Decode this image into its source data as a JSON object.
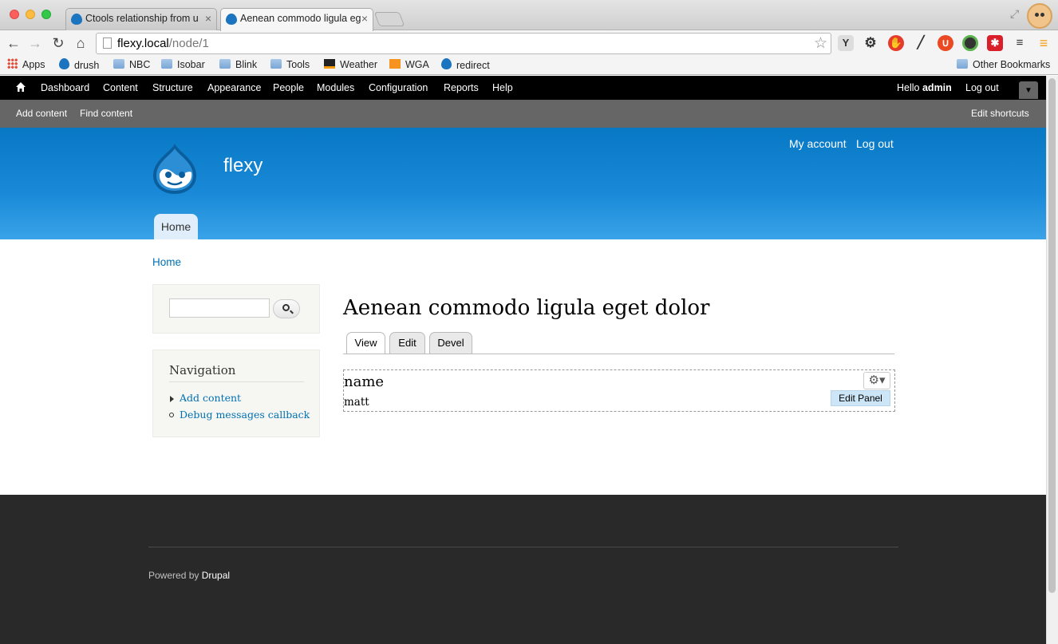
{
  "browser": {
    "tabs": [
      {
        "title": "Ctools relationship from u",
        "active": false
      },
      {
        "title": "Aenean commodo ligula eg",
        "active": true
      }
    ],
    "url": {
      "host": "flexy.local",
      "path": "/node/1"
    },
    "extensions": [
      "Y",
      "gear",
      "hand",
      "eyedropper",
      "stumbleupon",
      "chrome",
      "star-red",
      "tree",
      "menu"
    ],
    "bookmarks": [
      {
        "label": "Apps",
        "icon": "apps-icon"
      },
      {
        "label": "drush",
        "icon": "drupal-icon"
      },
      {
        "label": "NBC",
        "icon": "folder-icon"
      },
      {
        "label": "Isobar",
        "icon": "folder-icon"
      },
      {
        "label": "Blink",
        "icon": "folder-icon"
      },
      {
        "label": "Tools",
        "icon": "folder-icon"
      },
      {
        "label": "Weather",
        "icon": "weather-icon"
      },
      {
        "label": "WGA",
        "icon": "wga-icon"
      },
      {
        "label": "redirect",
        "icon": "drupal-icon"
      }
    ],
    "other_bookmarks": "Other Bookmarks"
  },
  "admin_menu": {
    "items": [
      "Dashboard",
      "Content",
      "Structure",
      "Appearance",
      "People",
      "Modules",
      "Configuration",
      "Reports",
      "Help"
    ],
    "hello": "Hello",
    "user": "admin",
    "logout": "Log out"
  },
  "shortcuts": {
    "items": [
      "Add content",
      "Find content"
    ],
    "edit": "Edit shortcuts"
  },
  "site": {
    "name": "flexy",
    "secondary_menu": [
      "My account",
      "Log out"
    ],
    "main_menu": [
      "Home"
    ]
  },
  "breadcrumb": "Home",
  "sidebar": {
    "search": {
      "value": "",
      "placeholder": ""
    },
    "navigation": {
      "title": "Navigation",
      "items": [
        "Add content",
        "Debug messages callback"
      ]
    }
  },
  "node": {
    "title": "Aenean commodo ligula eget dolor",
    "tabs": [
      "View",
      "Edit",
      "Devel"
    ],
    "panel": {
      "label": "name",
      "value": "matt",
      "menu_item": "Edit Panel"
    }
  },
  "footer": {
    "powered": "Powered by",
    "drupal": "Drupal"
  },
  "colors": {
    "header_blue": "#0778c4",
    "link_blue": "#0071b3",
    "footer_dark": "#292929"
  }
}
